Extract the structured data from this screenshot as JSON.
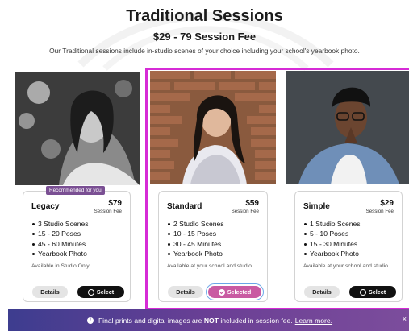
{
  "header": {
    "title": "Traditional Sessions",
    "subtitle": "$29 - 79 Session Fee",
    "description": "Our Traditional sessions include in-studio scenes of your choice including your school's yearbook photo."
  },
  "cards": [
    {
      "badge": "Recommended for you",
      "name": "Legacy",
      "price": "$79",
      "fee_label": "Session Fee",
      "features": [
        "3 Studio Scenes",
        "15 - 20 Poses",
        "45 - 60 Minutes",
        "Yearbook Photo"
      ],
      "availability": "Available in Studio Only",
      "details_label": "Details",
      "select_label": "Select",
      "selected": false
    },
    {
      "name": "Standard",
      "price": "$59",
      "fee_label": "Session Fee",
      "features": [
        "2 Studio Scenes",
        "10 - 15 Poses",
        "30 - 45 Minutes",
        "Yearbook Photo"
      ],
      "availability": "Available at your school and studio",
      "details_label": "Details",
      "select_label": "Selected",
      "selected": true
    },
    {
      "name": "Simple",
      "price": "$29",
      "fee_label": "Session Fee",
      "features": [
        "1 Studio Scenes",
        "5 - 10 Poses",
        "15 - 30 Minutes",
        "Yearbook Photo"
      ],
      "availability": "Available at your school and studio",
      "details_label": "Details",
      "select_label": "Select",
      "selected": false
    }
  ],
  "banner": {
    "text_before": "Final prints and digital images are",
    "text_bold": "NOT",
    "text_after": "included in session fee.",
    "link_text": "Learn more.",
    "close_symbol": "×"
  },
  "colors": {
    "highlight": "#d62bd6",
    "selected_button": "#c95aa2",
    "badge": "#7a4f93",
    "banner_start": "#3d3d8f",
    "banner_end": "#7c4d9c"
  }
}
